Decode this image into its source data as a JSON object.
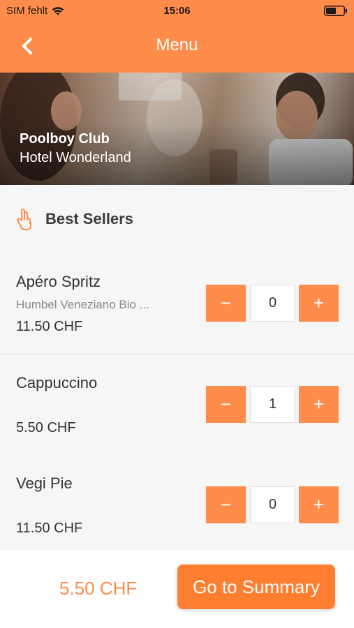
{
  "status_bar": {
    "carrier": "SIM fehlt",
    "time": "15:06",
    "icons": [
      "wifi-icon",
      "battery-icon"
    ]
  },
  "nav": {
    "title": "Menu",
    "back_icon": "chevron-left-icon"
  },
  "hero": {
    "venue_name": "Poolboy Club",
    "hotel_name": "Hotel Wonderland"
  },
  "section": {
    "label": "Best Sellers",
    "icon": "hand-peace-icon"
  },
  "items": [
    {
      "name": "Apéro Spritz",
      "description": "Humbel Veneziano Bio ...",
      "price": "11.50 CHF",
      "quantity": "0",
      "minus": "−",
      "plus": "+"
    },
    {
      "name": "Cappuccino",
      "description": "",
      "price": "5.50 CHF",
      "quantity": "1",
      "minus": "−",
      "plus": "+"
    },
    {
      "name": "Vegi Pie",
      "description": "",
      "price": "11.50 CHF",
      "quantity": "0",
      "minus": "−",
      "plus": "+"
    }
  ],
  "footer": {
    "total": "5.50 CHF",
    "cta_label": "Go to Summary"
  },
  "colors": {
    "accent": "#ff8c4a",
    "cta": "#ff7e2f",
    "background": "#f6f6f6"
  }
}
